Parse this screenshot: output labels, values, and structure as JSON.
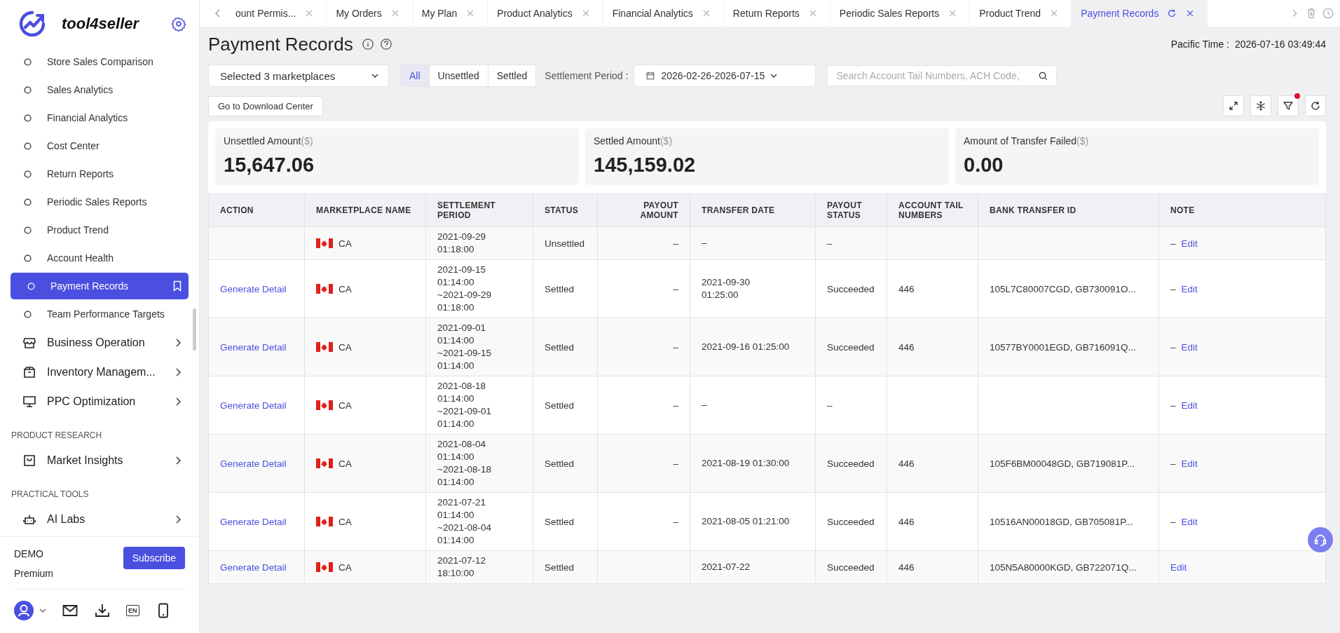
{
  "sidebar": {
    "brand": "tool4seller",
    "items": [
      {
        "kind": "sub",
        "label": "Store Sales Comparison",
        "selected": false
      },
      {
        "kind": "sub",
        "label": "Sales Analytics",
        "selected": false
      },
      {
        "kind": "sub",
        "label": "Financial Analytics",
        "selected": false
      },
      {
        "kind": "sub",
        "label": "Cost Center",
        "selected": false
      },
      {
        "kind": "sub",
        "label": "Return Reports",
        "selected": false
      },
      {
        "kind": "sub",
        "label": "Periodic Sales Reports",
        "selected": false
      },
      {
        "kind": "sub",
        "label": "Product Trend",
        "selected": false
      },
      {
        "kind": "sub",
        "label": "Account Health",
        "selected": false
      },
      {
        "kind": "sub",
        "label": "Payment Records",
        "selected": true
      },
      {
        "kind": "sub",
        "label": "Team Performance Targets",
        "selected": false
      },
      {
        "kind": "group",
        "label": "Business Operation"
      },
      {
        "kind": "group",
        "label": "Inventory Managem..."
      },
      {
        "kind": "group",
        "label": "PPC Optimization"
      },
      {
        "kind": "section",
        "label": "PRODUCT RESEARCH"
      },
      {
        "kind": "group",
        "label": "Market Insights"
      },
      {
        "kind": "section",
        "label": "PRACTICAL TOOLS"
      },
      {
        "kind": "group",
        "label": "AI Labs"
      }
    ],
    "account": {
      "name": "DEMO",
      "plan": "Premium",
      "subscribe": "Subscribe"
    },
    "language": "EN"
  },
  "tabs": [
    {
      "label": "ount Permis...",
      "selected": false
    },
    {
      "label": "My Orders",
      "selected": false
    },
    {
      "label": "My Plan",
      "selected": false
    },
    {
      "label": "Product Analytics",
      "selected": false
    },
    {
      "label": "Financial Analytics",
      "selected": false
    },
    {
      "label": "Return Reports",
      "selected": false
    },
    {
      "label": "Periodic Sales Reports",
      "selected": false
    },
    {
      "label": "Product Trend",
      "selected": false
    },
    {
      "label": "Payment Records",
      "selected": true
    }
  ],
  "page": {
    "title": "Payment Records",
    "time_label": "Pacific Time :",
    "time_value": "2026-07-16 03:49:44"
  },
  "filters": {
    "marketplaces": "Selected 3 marketplaces",
    "status_options": [
      {
        "label": "All",
        "selected": true
      },
      {
        "label": "Unsettled",
        "selected": false
      },
      {
        "label": "Settled",
        "selected": false
      }
    ],
    "period_label": "Settlement Period :",
    "period_value": "2026-02-26-2026-07-15",
    "search_placeholder": "Search Account Tail Numbers, ACH Code,",
    "download_button": "Go to Download Center",
    "filter_active": true
  },
  "summary": [
    {
      "label": "Unsettled Amount",
      "unit": "($)",
      "value": "15,647.06"
    },
    {
      "label": "Settled Amount",
      "unit": "($)",
      "value": "145,159.02"
    },
    {
      "label": "Amount of Transfer Failed",
      "unit": "($)",
      "value": "0.00"
    }
  ],
  "table": {
    "columns": [
      "ACTION",
      "MARKETPLACE NAME",
      "SETTLEMENT PERIOD",
      "STATUS",
      "PAYOUT AMOUNT",
      "TRANSFER DATE",
      "PAYOUT STATUS",
      "ACCOUNT TAIL NUMBERS",
      "BANK TRANSFER ID",
      "NOTE"
    ],
    "rows": [
      {
        "action": "",
        "marketplace": "CA",
        "period": [
          "2021-09-29",
          "01:18:00"
        ],
        "status": "Unsettled",
        "payout_amount": "–",
        "transfer_date": [
          "–"
        ],
        "payout_status": "–",
        "account_tail": "",
        "bank_transfer_id": "",
        "note": "–",
        "note_link": "Edit"
      },
      {
        "action": "Generate Detail",
        "marketplace": "CA",
        "period": [
          "2021-09-15",
          "01:14:00",
          "~2021-09-29",
          "01:18:00"
        ],
        "status": "Settled",
        "payout_amount": "–",
        "transfer_date": [
          "2021-09-30",
          "01:25:00"
        ],
        "payout_status": "Succeeded",
        "account_tail": "446",
        "bank_transfer_id": "105L7C80007CGD, GB730091O...",
        "note": "–",
        "note_link": "Edit"
      },
      {
        "action": "Generate Detail",
        "marketplace": "CA",
        "period": [
          "2021-09-01",
          "01:14:00",
          "~2021-09-15",
          "01:14:00"
        ],
        "status": "Settled",
        "payout_amount": "–",
        "transfer_date": [
          "2021-09-16 01:25:00"
        ],
        "payout_status": "Succeeded",
        "account_tail": "446",
        "bank_transfer_id": "10577BY0001EGD, GB716091Q...",
        "note": "–",
        "note_link": "Edit"
      },
      {
        "action": "Generate Detail",
        "marketplace": "CA",
        "period": [
          "2021-08-18",
          "01:14:00",
          "~2021-09-01",
          "01:14:00"
        ],
        "status": "Settled",
        "payout_amount": "–",
        "transfer_date": [
          "–"
        ],
        "payout_status": "–",
        "account_tail": "",
        "bank_transfer_id": "",
        "note": "–",
        "note_link": "Edit"
      },
      {
        "action": "Generate Detail",
        "marketplace": "CA",
        "period": [
          "2021-08-04",
          "01:14:00",
          "~2021-08-18",
          "01:14:00"
        ],
        "status": "Settled",
        "payout_amount": "–",
        "transfer_date": [
          "2021-08-19 01:30:00"
        ],
        "payout_status": "Succeeded",
        "account_tail": "446",
        "bank_transfer_id": "105F6BM00048GD, GB719081P...",
        "note": "–",
        "note_link": "Edit"
      },
      {
        "action": "Generate Detail",
        "marketplace": "CA",
        "period": [
          "2021-07-21",
          "01:14:00",
          "~2021-08-04",
          "01:14:00"
        ],
        "status": "Settled",
        "payout_amount": "–",
        "transfer_date": [
          "2021-08-05 01:21:00"
        ],
        "payout_status": "Succeeded",
        "account_tail": "446",
        "bank_transfer_id": "10516AN00018GD, GB705081P...",
        "note": "–",
        "note_link": "Edit"
      },
      {
        "action": "Generate Detail",
        "marketplace": "CA",
        "period": [
          "2021-07-12",
          "18:10:00"
        ],
        "status": "Settled",
        "payout_amount": "",
        "transfer_date": [
          "2021-07-22"
        ],
        "payout_status": "Succeeded",
        "account_tail": "446",
        "bank_transfer_id": "105N5A80000KGD, GB722071Q...",
        "note": "",
        "note_link": "Edit"
      }
    ]
  }
}
